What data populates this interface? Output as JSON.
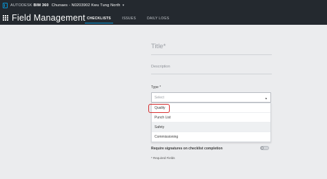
{
  "header": {
    "brand_prefix": "AUTODESK",
    "brand_product": "BIM 360",
    "project": "Chunaes - N0203902 Kwu Tung North",
    "app_title": "Field Management",
    "tabs": [
      {
        "label": "CHECKLISTS",
        "active": true
      },
      {
        "label": "ISSUES",
        "active": false
      },
      {
        "label": "DAILY LOGS",
        "active": false
      }
    ]
  },
  "form": {
    "title_placeholder": "Title*",
    "description_placeholder": "Description",
    "type_label": "Type *",
    "select_placeholder": "Select",
    "options": [
      {
        "label": "Quality",
        "highlighted": true
      },
      {
        "label": "Punch List",
        "highlighted": false
      },
      {
        "label": "Safety",
        "highlighted": false
      },
      {
        "label": "Commissioning",
        "highlighted": false
      }
    ],
    "require_signatures_label": "Require signatures on checklist completion",
    "require_signatures_on": false,
    "required_note": "* Required Fields"
  },
  "colors": {
    "topbar": "#24292f",
    "accent": "#0696d7",
    "highlight_ring": "#d52b2b",
    "background": "#ebecee"
  }
}
